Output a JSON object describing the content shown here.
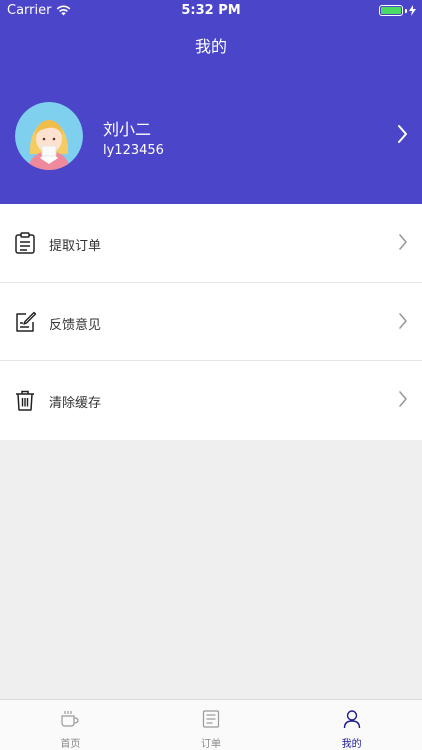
{
  "status_bar": {
    "carrier": "Carrier",
    "time": "5:32 PM"
  },
  "header": {
    "title": "我的"
  },
  "profile": {
    "name": "刘小二",
    "id": "ly123456"
  },
  "menu": [
    {
      "label": "提取订单",
      "icon": "clipboard-icon"
    },
    {
      "label": "反馈意见",
      "icon": "edit-icon"
    },
    {
      "label": "清除缓存",
      "icon": "trash-icon"
    }
  ],
  "tabbar": [
    {
      "label": "首页",
      "icon": "cup-icon",
      "active": false
    },
    {
      "label": "订单",
      "icon": "list-icon",
      "active": false
    },
    {
      "label": "我的",
      "icon": "user-icon",
      "active": true
    }
  ],
  "colors": {
    "header_bg": "#4b45c9",
    "active_tab": "#1f1a8f",
    "battery": "#4cd964"
  }
}
